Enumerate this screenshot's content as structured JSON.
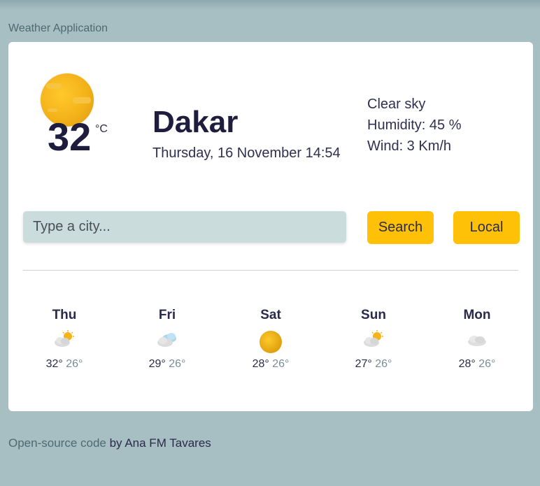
{
  "app": {
    "title": "Weather Application"
  },
  "current": {
    "temperature": "32",
    "unit": "°C",
    "city": "Dakar",
    "datetime": "Thursday, 16 November 14:54",
    "description": "Clear sky",
    "humidity": "Humidity: 45 %",
    "wind": "Wind: 3 Km/h",
    "icon": "sun-icon"
  },
  "search": {
    "placeholder": "Type a city...",
    "search_label": "Search",
    "local_label": "Local"
  },
  "forecast": [
    {
      "day": "Thu",
      "max": "32°",
      "min": "26°",
      "icon": "partly-cloudy-icon"
    },
    {
      "day": "Fri",
      "max": "29°",
      "min": "26°",
      "icon": "cloudy-blue-icon"
    },
    {
      "day": "Sat",
      "max": "28°",
      "min": "26°",
      "icon": "sun-icon"
    },
    {
      "day": "Sun",
      "max": "27°",
      "min": "26°",
      "icon": "partly-cloudy-icon"
    },
    {
      "day": "Mon",
      "max": "28°",
      "min": "26°",
      "icon": "cloud-icon"
    }
  ],
  "footer": {
    "link_text": "Open-source code",
    "suffix": " by Ana FM Tavares"
  },
  "colors": {
    "background": "#a7bfc3",
    "card": "#ffffff",
    "accent": "#ffc107",
    "input_bg": "#cbdcdd"
  }
}
